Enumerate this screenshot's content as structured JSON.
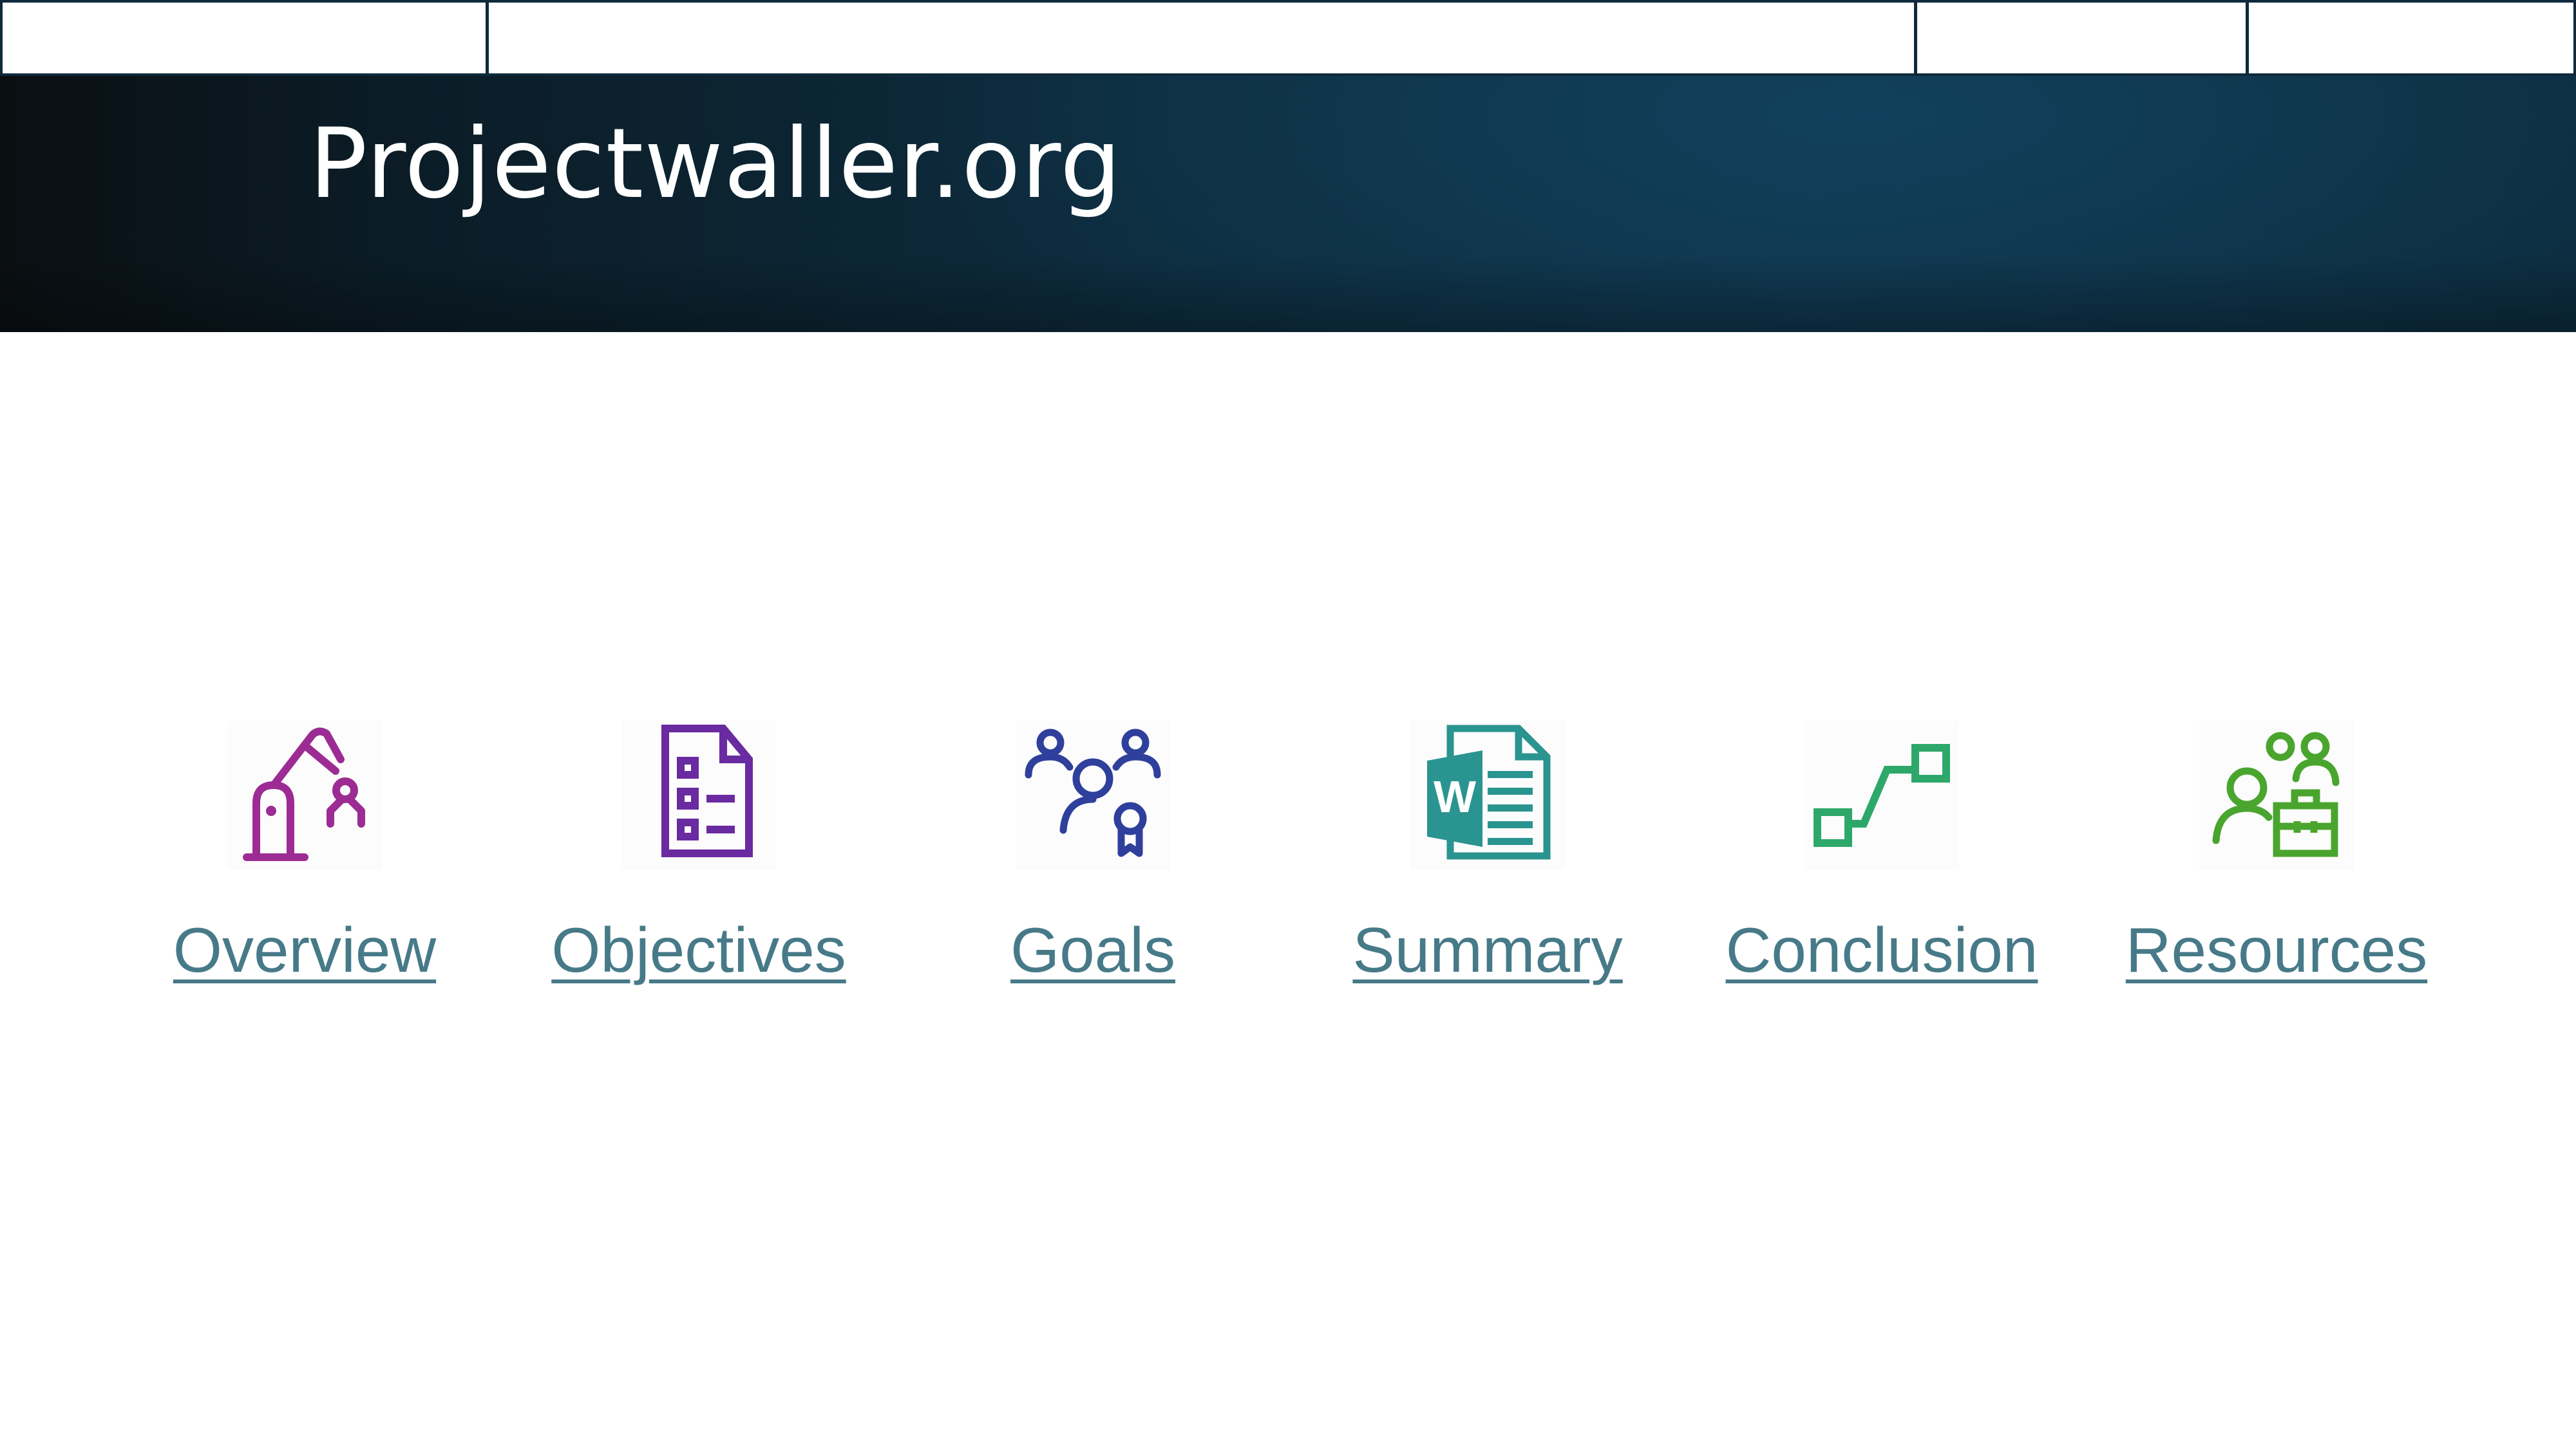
{
  "header": {
    "site_title": "Projectwaller.org"
  },
  "nav": {
    "items": [
      {
        "label": "Overview",
        "icon": "robot-arm-icon",
        "color": "#9c2c93"
      },
      {
        "label": "Objectives",
        "icon": "checklist-icon",
        "color": "#6a2aa0"
      },
      {
        "label": "Goals",
        "icon": "team-award-icon",
        "color": "#2f3f9c"
      },
      {
        "label": "Summary",
        "icon": "word-document-icon",
        "color": "#2a9490"
      },
      {
        "label": "Conclusion",
        "icon": "connector-line-icon",
        "color": "#2ea86a"
      },
      {
        "label": "Resources",
        "icon": "team-toolbox-icon",
        "color": "#4aa52e"
      }
    ]
  },
  "colors": {
    "link": "#477a88",
    "banner": "#0e3147",
    "outline": "#0e2a3b"
  }
}
